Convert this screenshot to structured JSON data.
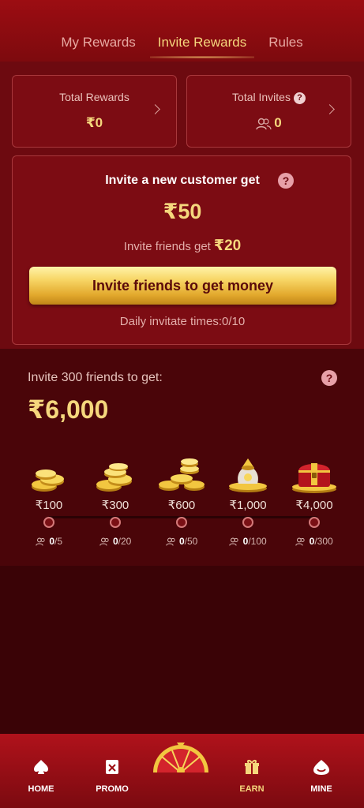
{
  "tabs": [
    {
      "label": "My Rewards",
      "active": false
    },
    {
      "label": "Invite Rewards",
      "active": true
    },
    {
      "label": "Rules",
      "active": false
    }
  ],
  "stats": {
    "total_rewards_label": "Total Rewards",
    "total_rewards_value": "₹0",
    "total_invites_label": "Total Invites",
    "total_invites_value": "0"
  },
  "invite": {
    "title": "Invite a new customer get",
    "amount": "₹50",
    "friends_text": "Invite friends get",
    "friends_amount": "₹20",
    "button_label": "Invite friends to get money",
    "daily_text": "Daily invitate times:0/10"
  },
  "milestone": {
    "title": "Invite 300 friends to get:",
    "amount": "₹6,000",
    "tiers": [
      {
        "value": "₹100",
        "current": "0",
        "target": "/5",
        "art": "coins-small"
      },
      {
        "value": "₹300",
        "current": "0",
        "target": "/20",
        "art": "coins-stack"
      },
      {
        "value": "₹600",
        "current": "0",
        "target": "/50",
        "art": "coins-pile"
      },
      {
        "value": "₹1,000",
        "current": "0",
        "target": "/100",
        "art": "coin-bag"
      },
      {
        "value": "₹4,000",
        "current": "0",
        "target": "/300",
        "art": "treasure-chest"
      }
    ]
  },
  "nav": {
    "home": "HOME",
    "promo": "PROMO",
    "earn": "EARN",
    "mine": "MINE"
  },
  "colors": {
    "accent_gold": "#f5d77d",
    "primary_red": "#9c0d12",
    "background": "#3a0306"
  }
}
